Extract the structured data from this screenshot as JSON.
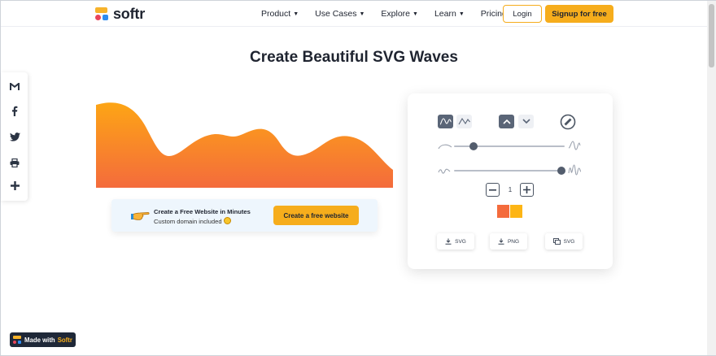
{
  "header": {
    "logo_text": "softr",
    "nav": [
      {
        "label": "Product",
        "dropdown": true
      },
      {
        "label": "Use Cases",
        "dropdown": true
      },
      {
        "label": "Explore",
        "dropdown": true
      },
      {
        "label": "Learn",
        "dropdown": true
      },
      {
        "label": "Pricing",
        "dropdown": false
      }
    ],
    "login_label": "Login",
    "signup_label": "Signup for free"
  },
  "share_bar": {
    "icons": [
      "gmail-icon",
      "facebook-icon",
      "twitter-icon",
      "print-icon",
      "plus-icon"
    ]
  },
  "page_title": "Create Beautiful SVG Waves",
  "wave": {
    "gradient_top": "#fda515",
    "gradient_bottom": "#f46b3c"
  },
  "promo": {
    "headline": "Create a Free Website in Minutes",
    "subline": "Custom domain included",
    "button_label": "Create a free website"
  },
  "controls": {
    "wave_types": [
      "smooth-wave-icon",
      "peak-wave-icon"
    ],
    "direction_buttons": [
      "chevron-up-icon",
      "chevron-down-icon"
    ],
    "randomize_icon": "randomize-icon",
    "amplitude_slider": {
      "min_icon": "low-amplitude-icon",
      "max_icon": "high-amplitude-icon",
      "value": 0.18
    },
    "frequency_slider": {
      "min_icon": "low-frequency-icon",
      "max_icon": "high-frequency-icon",
      "value": 0.97
    },
    "layers": {
      "minus": "−",
      "value": "1",
      "plus": "+"
    },
    "colors": [
      "#f46b3c",
      "#fdb515"
    ],
    "downloads": [
      {
        "label": "SVG",
        "icon": "download-icon"
      },
      {
        "label": "PNG",
        "icon": "download-icon"
      },
      {
        "label": "SVG",
        "icon": "copy-icon"
      }
    ]
  },
  "badge": {
    "prefix": "Made with",
    "brand": "Softr"
  }
}
